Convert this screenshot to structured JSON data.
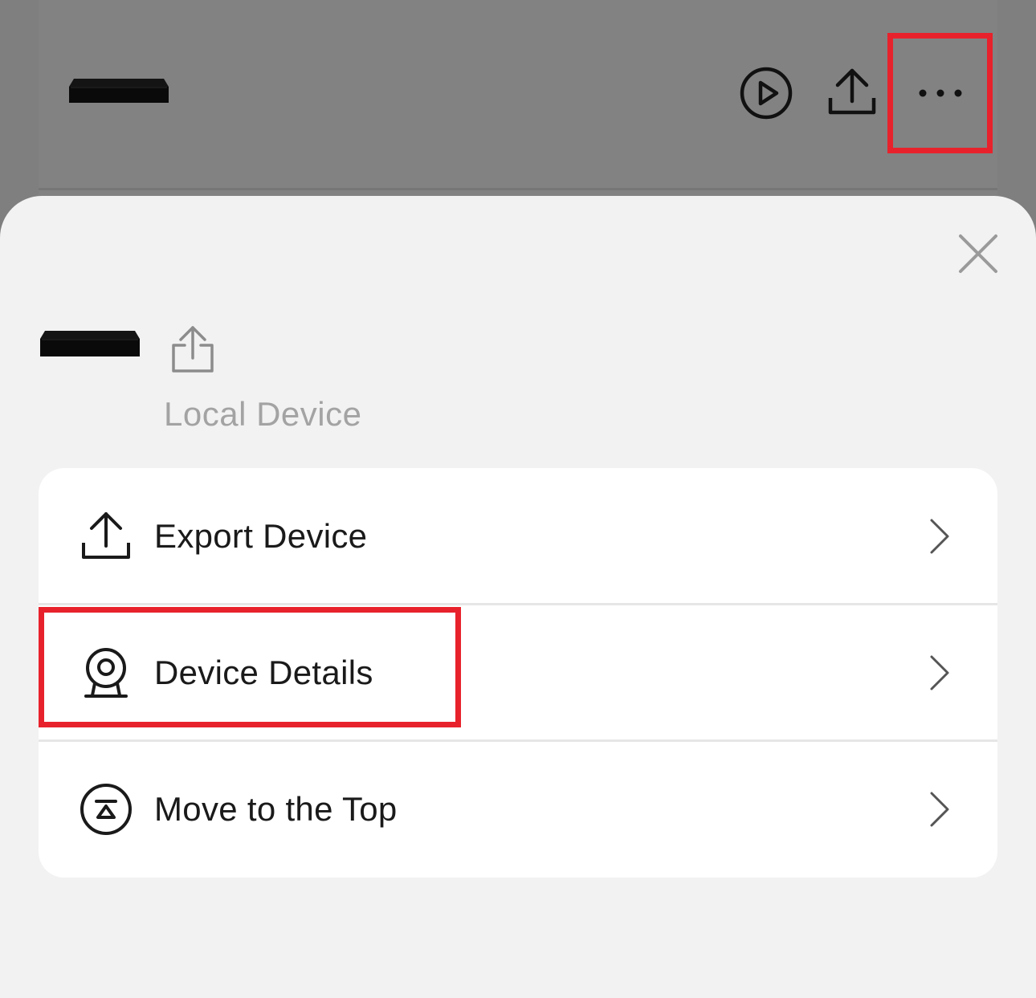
{
  "background": {
    "device_image": "nvr-device-image",
    "actions": [
      {
        "icon": "play-circle-icon"
      },
      {
        "icon": "share-upload-icon"
      },
      {
        "icon": "more-horizontal-icon"
      }
    ]
  },
  "sheet": {
    "close_icon": "close-icon",
    "device_image": "nvr-device-image",
    "share_icon": "share-upload-icon",
    "device_name": "Local Device"
  },
  "menu": {
    "items": [
      {
        "label": "Export Device",
        "icon": "export-upload-icon"
      },
      {
        "label": "Device Details",
        "icon": "camera-details-icon"
      },
      {
        "label": "Move to the Top",
        "icon": "move-to-top-icon"
      }
    ]
  },
  "colors": {
    "overlay": "#7f7f7f",
    "sheet": "#f2f2f2",
    "card": "#ffffff",
    "highlight": "#e8222c",
    "text_primary": "#1a1a1a",
    "text_muted": "#a3a3a3"
  }
}
